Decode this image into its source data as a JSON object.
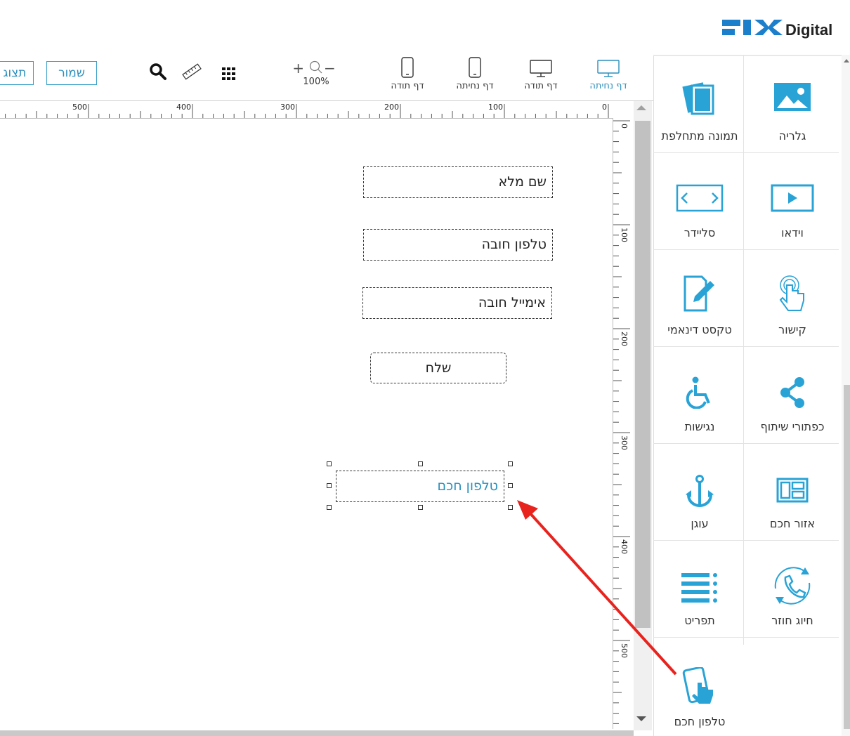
{
  "logo": {
    "fix": "FIX",
    "digital": "Digital"
  },
  "toolbar": {
    "save_label": "שמור",
    "preview_label": "תצוג",
    "zoom_level": "100%",
    "zoom_plus": "+",
    "zoom_minus": "−",
    "devices": [
      {
        "label": "דף נחיתה",
        "icon": "desktop-icon",
        "active": true
      },
      {
        "label": "דף תודה",
        "icon": "desktop-icon"
      },
      {
        "label": "דף נחיתה",
        "icon": "mobile-icon"
      },
      {
        "label": "דף תודה",
        "icon": "mobile-icon"
      }
    ],
    "tools": [
      "grid-icon",
      "ruler-icon",
      "search-icon"
    ]
  },
  "ruler": {
    "horizontal": [
      "0",
      "100",
      "200",
      "300",
      "400",
      "500"
    ],
    "vertical": [
      "0",
      "100",
      "200",
      "300",
      "400",
      "500"
    ]
  },
  "canvas": {
    "fields": [
      {
        "name": "full-name-field",
        "label": "שם מלא"
      },
      {
        "name": "phone-field",
        "label": "טלפון חובה"
      },
      {
        "name": "email-field",
        "label": "אימייל חובה"
      }
    ],
    "submit_label": "שלח",
    "smart_phone_label": "טלפון חכם"
  },
  "panel": {
    "items": [
      {
        "label": "גלריה",
        "icon": "image-icon"
      },
      {
        "label": "תמונה מתחלפת",
        "icon": "gallery-stack-icon"
      },
      {
        "label": "וידאו",
        "icon": "video-icon"
      },
      {
        "label": "סליידר",
        "icon": "slider-icon"
      },
      {
        "label": "קישור",
        "icon": "link-tap-icon"
      },
      {
        "label": "טקסט דינאמי",
        "icon": "edit-document-icon"
      },
      {
        "label": "כפתורי שיתוף",
        "icon": "share-icon"
      },
      {
        "label": "נגישות",
        "icon": "accessibility-icon"
      },
      {
        "label": "אזור חכם",
        "icon": "smart-area-icon"
      },
      {
        "label": "עוגן",
        "icon": "anchor-icon"
      },
      {
        "label": "חיוג חוזר",
        "icon": "callback-phone-icon"
      },
      {
        "label": "תפריט",
        "icon": "menu-icon"
      },
      {
        "label": "טלפון חכם",
        "icon": "smartphone-tap-icon"
      }
    ]
  },
  "colors": {
    "accent": "#2a8fbd",
    "icon": "#29a3d6",
    "arrow": "#e8231e"
  }
}
